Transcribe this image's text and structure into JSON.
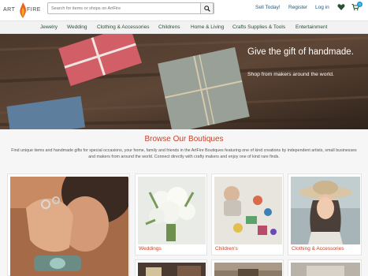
{
  "header": {
    "logo_left": "ART",
    "logo_right": "FIRE",
    "search_placeholder": "Search for items or shops on ArtFire",
    "links": {
      "sell": "Sell Today!",
      "register": "Register",
      "login": "Log in"
    },
    "cart_count": "0"
  },
  "nav": {
    "items": [
      "Jewelry",
      "Wedding",
      "Clothing & Accessories",
      "Childrens",
      "Home & Living",
      "Crafts Supplies & Tools",
      "Entertainment"
    ]
  },
  "hero": {
    "title": "Give the gift of handmade.",
    "subtitle": "Shop from makers around the world."
  },
  "section": {
    "title": "Browse Our Boutiques",
    "description": "Find unique items and handmade gifts for special occasions, your home, family and friends in the ArtFire Boutiques featuring one of kind creations by independent artists, small businesses and makers from around the world. Connect directly with crafty makers and enjoy one of kind rare finds."
  },
  "cards": {
    "weddings": "Weddings",
    "childrens": "Children's",
    "clothing": "Clothing & Accessories"
  },
  "colors": {
    "accent": "#c5432e",
    "link": "#2a5a78",
    "nav_text": "#2a4f33",
    "badge": "#1a9ad6"
  }
}
